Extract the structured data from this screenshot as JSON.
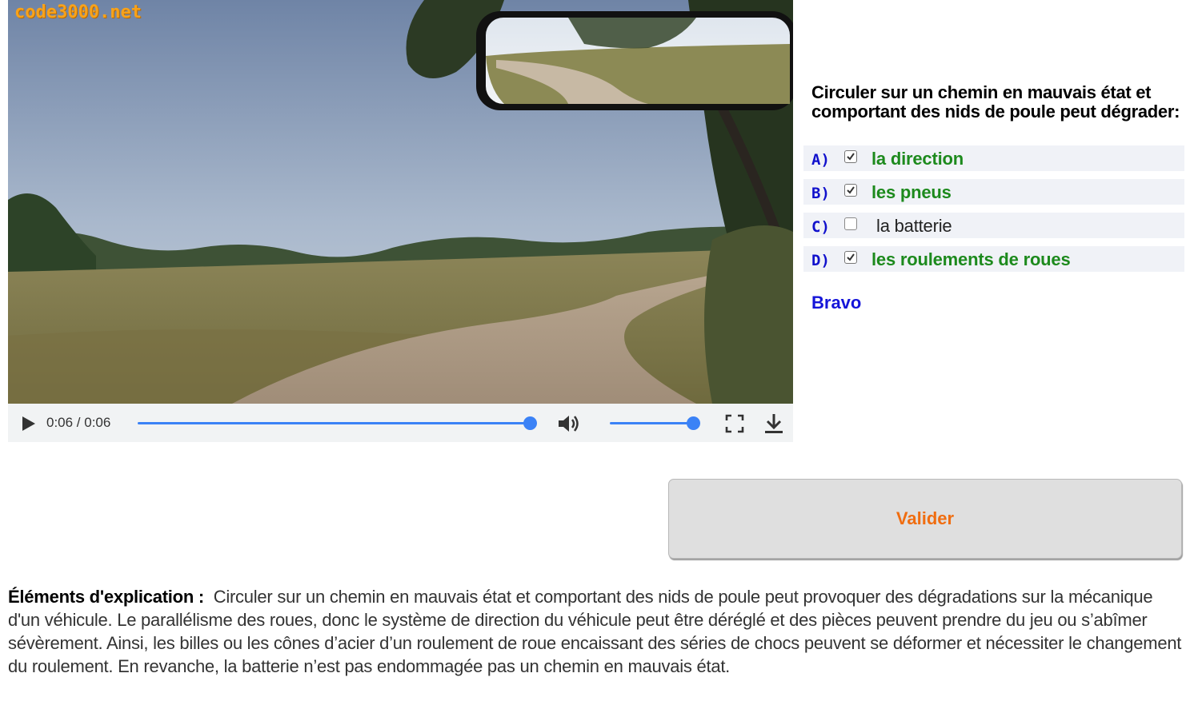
{
  "video": {
    "watermark": "code3000.net",
    "current_time": "0:06",
    "duration": "0:06",
    "time_display": "0:06 / 0:06",
    "progress": 1.0,
    "volume": 1.0,
    "icons": [
      "play-icon",
      "volume-icon",
      "fullscreen-icon",
      "download-icon"
    ]
  },
  "quiz": {
    "question": "Circuler sur un chemin en mauvais état et comportant des nids de poule peut dégrader:",
    "answers": [
      {
        "letter": "A)",
        "label": "la direction",
        "checked": true,
        "correct": true
      },
      {
        "letter": "B)",
        "label": "les pneus",
        "checked": true,
        "correct": true
      },
      {
        "letter": "C)",
        "label": "la batterie",
        "checked": false,
        "correct": false
      },
      {
        "letter": "D)",
        "label": "les roulements de roues",
        "checked": true,
        "correct": true
      }
    ],
    "result": "Bravo",
    "validate_label": "Valider"
  },
  "explanation": {
    "heading": "Éléments d'explication :",
    "text": "Circuler sur un chemin en mauvais état et comportant des nids de poule peut provoquer des dégradations sur la mécanique d'un véhicule. Le parallélisme des roues, donc le système de direction du véhicule peut être déréglé et des pièces peuvent prendre du jeu ou s’abîmer sévèrement. Ainsi, les billes ou les cônes d’acier d’un roulement de roue encaissant des séries de chocs peuvent se déformer et nécessiter le changement du roulement. En revanche, la batterie n’est pas endommagée pas un chemin en mauvais état."
  },
  "colors": {
    "answer_correct": "#1d8a1d",
    "answer_letter": "#1111cc",
    "result": "#1515d9",
    "validate_text": "#f06d10",
    "watermark": "#f7a21b",
    "player_accent": "#3b82f6"
  }
}
